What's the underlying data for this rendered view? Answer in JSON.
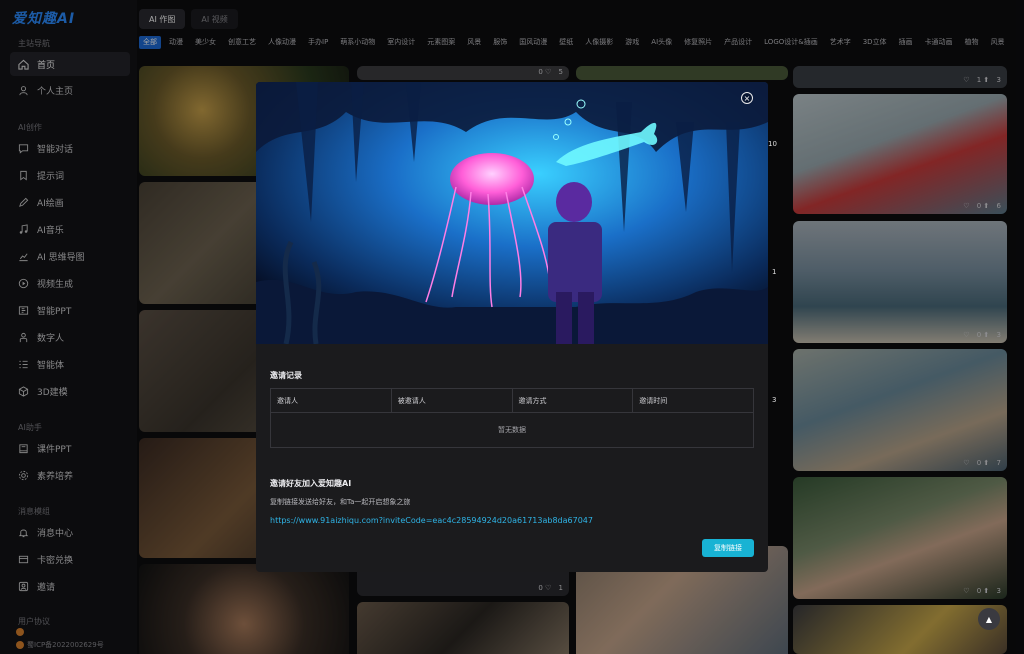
{
  "app": {
    "logo": "爱知趣AI"
  },
  "sidebar": {
    "groups": [
      {
        "label": "主站导航"
      },
      {
        "label": "AI创作"
      },
      {
        "label": "AI助手"
      },
      {
        "label": "消息模组"
      },
      {
        "label": "用户协议"
      }
    ],
    "items": [
      {
        "label": "首页",
        "icon": "home-icon"
      },
      {
        "label": "个人主页",
        "icon": "user-icon"
      },
      {
        "label": "智能对话",
        "icon": "chat-icon"
      },
      {
        "label": "提示词",
        "icon": "bookmark-icon"
      },
      {
        "label": "AI绘画",
        "icon": "pen-icon"
      },
      {
        "label": "AI音乐",
        "icon": "music-icon"
      },
      {
        "label": "AI 思维导图",
        "icon": "chart-icon"
      },
      {
        "label": "视频生成",
        "icon": "play-icon"
      },
      {
        "label": "智能PPT",
        "icon": "ppt-icon"
      },
      {
        "label": "数字人",
        "icon": "person-icon"
      },
      {
        "label": "智能体",
        "icon": "list-icon"
      },
      {
        "label": "3D建模",
        "icon": "cube-icon"
      },
      {
        "label": "课件PPT",
        "icon": "book-icon"
      },
      {
        "label": "素养培养",
        "icon": "gear-icon"
      },
      {
        "label": "消息中心",
        "icon": "bell-icon"
      },
      {
        "label": "卡密兑换",
        "icon": "card-icon"
      },
      {
        "label": "邀请",
        "icon": "invite-icon"
      }
    ],
    "icp": "蜀ICP备2022002629号"
  },
  "top_tabs": [
    {
      "label": "AI 作图"
    },
    {
      "label": "AI 视频"
    }
  ],
  "categories": [
    "全部",
    "动漫",
    "美少女",
    "创意工艺",
    "人像动漫",
    "手办IP",
    "萌系小动物",
    "室内设计",
    "元素图案",
    "风景",
    "服饰",
    "国风动漫",
    "壁纸",
    "人像摄影",
    "游戏",
    "AI头像",
    "修复照片",
    "产品设计",
    "LOGO设计&插画",
    "艺术字",
    "3D立体",
    "插画",
    "卡通动画",
    "植物",
    "风景"
  ],
  "cards": [
    {
      "likes": "0",
      "uses": "5"
    },
    {
      "likes": "1",
      "uses": "3"
    },
    {
      "likes": "0",
      "uses": "6"
    },
    {
      "likes": "0",
      "uses": "3"
    },
    {
      "likes": "0",
      "uses": "7"
    },
    {
      "likes": "0",
      "uses": "3"
    },
    {
      "likes": "0",
      "uses": "1"
    },
    {
      "likes": "",
      "uses": "10"
    },
    {
      "likes": "",
      "uses": "1"
    },
    {
      "likes": "",
      "uses": "3"
    }
  ],
  "modal": {
    "records_title": "邀请记录",
    "columns": [
      "邀请人",
      "被邀请人",
      "邀请方式",
      "邀请时间"
    ],
    "empty_text": "暂无数据",
    "invite_title": "邀请好友加入爱知趣AI",
    "invite_desc": "复制链接发送给好友，和Ta一起开启想象之旅",
    "invite_link": "https://www.91aizhiqu.com?inviteCode=eac4c28594924d20a61713ab8da67047",
    "copy_label": "复制链接",
    "close_symbol": "×"
  },
  "to_top_symbol": "▲"
}
